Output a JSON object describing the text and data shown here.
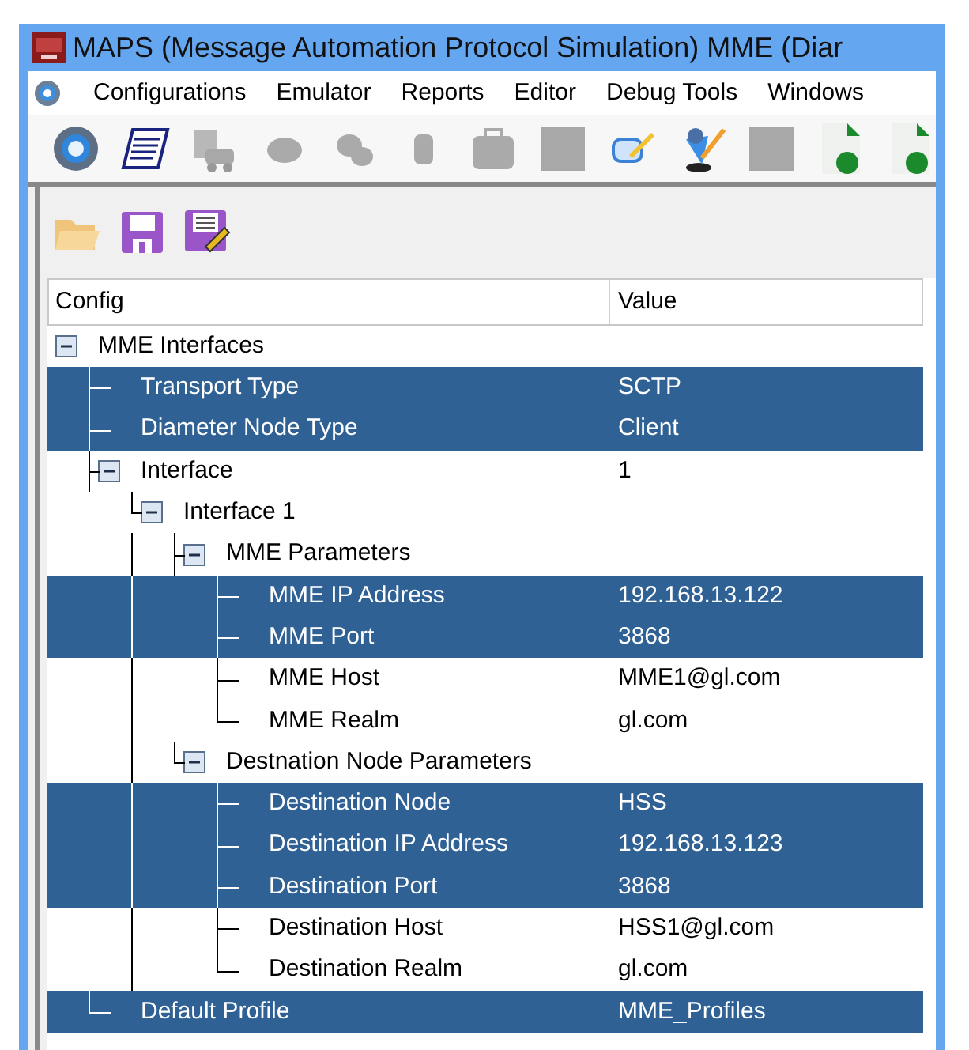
{
  "window": {
    "title": "MAPS (Message Automation Protocol Simulation) MME (Diar"
  },
  "menu": [
    "Configurations",
    "Emulator",
    "Reports",
    "Editor",
    "Debug Tools",
    "Windows"
  ],
  "tree": {
    "columns": [
      "Config",
      "Value"
    ],
    "rows": [
      {
        "label": "MME Interfaces",
        "selected": false,
        "expanded": true,
        "children": [
          {
            "label": "Transport Type",
            "value": "SCTP",
            "selected": true
          },
          {
            "label": "Diameter Node Type",
            "value": "Client",
            "selected": true
          },
          {
            "label": "Interface",
            "value": "1",
            "selected": false,
            "expanded": true,
            "children": [
              {
                "label": "Interface 1",
                "selected": false,
                "expanded": true,
                "children": [
                  {
                    "label": "MME Parameters",
                    "selected": false,
                    "expanded": true,
                    "children": [
                      {
                        "label": "MME IP Address",
                        "value": "192.168.13.122",
                        "selected": true
                      },
                      {
                        "label": "MME Port",
                        "value": "3868",
                        "selected": true
                      },
                      {
                        "label": "MME Host",
                        "value": "MME1@gl.com",
                        "selected": false
                      },
                      {
                        "label": "MME Realm",
                        "value": "gl.com",
                        "selected": false
                      }
                    ]
                  },
                  {
                    "label": "Destnation Node Parameters",
                    "selected": false,
                    "expanded": true,
                    "children": [
                      {
                        "label": "Destination Node",
                        "value": "HSS",
                        "selected": true
                      },
                      {
                        "label": "Destination IP Address",
                        "value": "192.168.13.123",
                        "selected": true
                      },
                      {
                        "label": "Destination Port",
                        "value": "3868",
                        "selected": true
                      },
                      {
                        "label": "Destination Host",
                        "value": "HSS1@gl.com",
                        "selected": false
                      },
                      {
                        "label": "Destination Realm",
                        "value": "gl.com",
                        "selected": false
                      }
                    ]
                  }
                ]
              }
            ]
          },
          {
            "label": "Default Profile",
            "value": "MME_Profiles",
            "selected": true
          }
        ]
      }
    ]
  }
}
